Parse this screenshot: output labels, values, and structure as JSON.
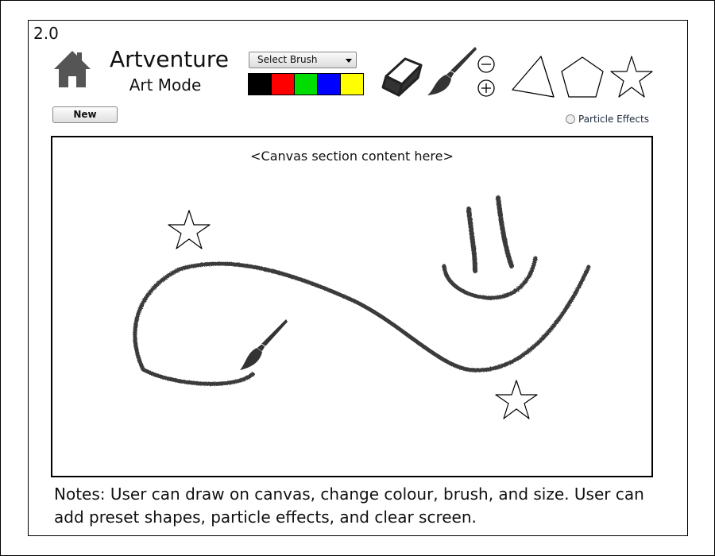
{
  "version": "2.0",
  "app": {
    "title": "Artventure",
    "subtitle": "Art Mode"
  },
  "toolbar": {
    "brush_select_label": "Select Brush",
    "colors": [
      "#000000",
      "#ff0000",
      "#00dd00",
      "#0000ff",
      "#ffff00"
    ],
    "new_label": "New",
    "particle_effects_label": "Particle Effects"
  },
  "canvas": {
    "placeholder": "<Canvas section content here>"
  },
  "notes": "Notes: User can draw on canvas, change colour, brush, and size. User can add preset shapes, particle effects, and clear screen."
}
